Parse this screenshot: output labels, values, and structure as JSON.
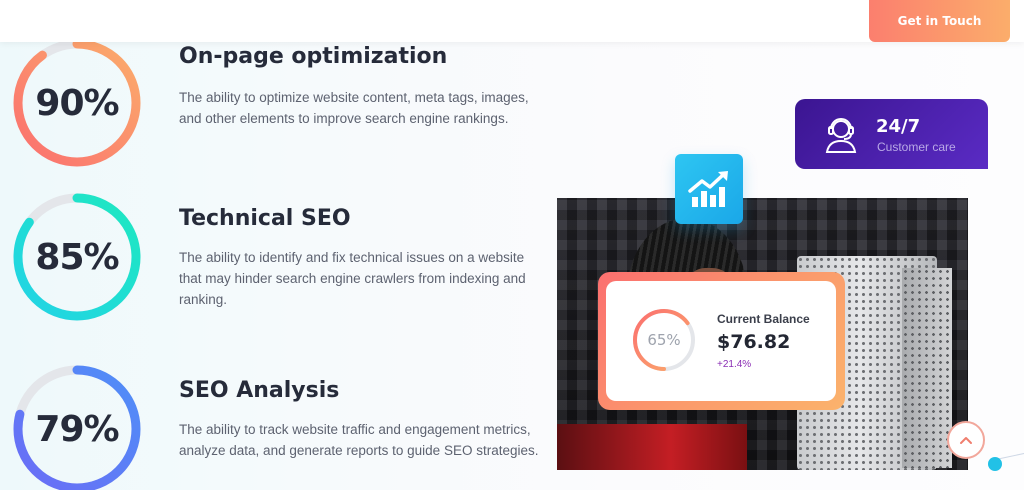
{
  "header": {
    "cta_label": "Get in Touch"
  },
  "skills": [
    {
      "percent_label": "90%",
      "percent": 90,
      "title": "On-page optimization",
      "description": "The ability to optimize website content, meta tags, images, and other elements to improve search engine rankings.",
      "color_start": "#fb6f6f",
      "color_end": "#fbad6b"
    },
    {
      "percent_label": "85%",
      "percent": 85,
      "title": "Technical SEO",
      "description": "The ability to identify and fix technical issues on a website that may hinder search engine crawlers from indexing and ranking.",
      "color_start": "#22d3e6",
      "color_end": "#1ee8c0"
    },
    {
      "percent_label": "79%",
      "percent": 79,
      "title": "SEO Analysis",
      "description": "The ability to track website traffic and engagement metrics, analyze data, and generate reports to guide SEO strategies.",
      "color_start": "#6b6cf6",
      "color_end": "#4f8ff7"
    }
  ],
  "support_card": {
    "value": "24/7",
    "label": "Customer care",
    "icon": "headset-agent-icon"
  },
  "badge": {
    "icon": "trending-up-chart-icon"
  },
  "balance_card": {
    "percent_label": "65%",
    "percent": 65,
    "label": "Current Balance",
    "value": "$76.82",
    "change": "+21.4%"
  },
  "scroll_top": {
    "icon": "chevron-up-icon"
  },
  "colors": {
    "track": "#e4e6ea",
    "accent_coral": "#fb7f6e",
    "accent_cyan": "#22c1e6",
    "care_purple": "#3b1591"
  }
}
